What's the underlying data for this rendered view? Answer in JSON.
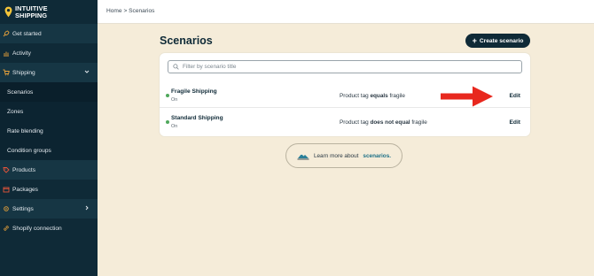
{
  "brand": {
    "line1": "INTUITIVE",
    "line2": "SHIPPING"
  },
  "sidebar": {
    "items": [
      {
        "label": "Get started",
        "icon": "rocket-icon"
      },
      {
        "label": "Activity",
        "icon": "chart-icon"
      },
      {
        "label": "Shipping",
        "icon": "cart-icon",
        "expanded": true
      },
      {
        "label": "Scenarios",
        "sub": true,
        "active": true
      },
      {
        "label": "Zones",
        "sub": true
      },
      {
        "label": "Rate blending",
        "sub": true
      },
      {
        "label": "Condition groups",
        "sub": true
      },
      {
        "label": "Products",
        "icon": "tag-icon"
      },
      {
        "label": "Packages",
        "icon": "box-icon"
      },
      {
        "label": "Settings",
        "icon": "gear-icon",
        "collapsed": true
      },
      {
        "label": "Shopify connection",
        "icon": "link-icon"
      }
    ]
  },
  "breadcrumb": {
    "home": "Home",
    "separator": ">",
    "current": "Scenarios"
  },
  "page": {
    "title": "Scenarios",
    "create_label": "Create scenario"
  },
  "search": {
    "placeholder": "Filter by scenario title"
  },
  "scenarios": [
    {
      "title": "Fragile Shipping",
      "status": "On",
      "condition_prefix": "Product tag",
      "operator": "equals",
      "value": "fragile",
      "edit_label": "Edit"
    },
    {
      "title": "Standard Shipping",
      "status": "On",
      "condition_prefix": "Product tag",
      "operator": "does not equal",
      "value": "fragile",
      "edit_label": "Edit"
    }
  ],
  "learn_more": {
    "text": "Learn more about",
    "link": "scenarios."
  },
  "colors": {
    "sidebar": "#0f2a37",
    "background": "#f5ecd9",
    "accent_yellow": "#f3c53a",
    "status_green": "#4fa85c",
    "annotation_arrow": "#e8281e",
    "link": "#1b6f86"
  }
}
